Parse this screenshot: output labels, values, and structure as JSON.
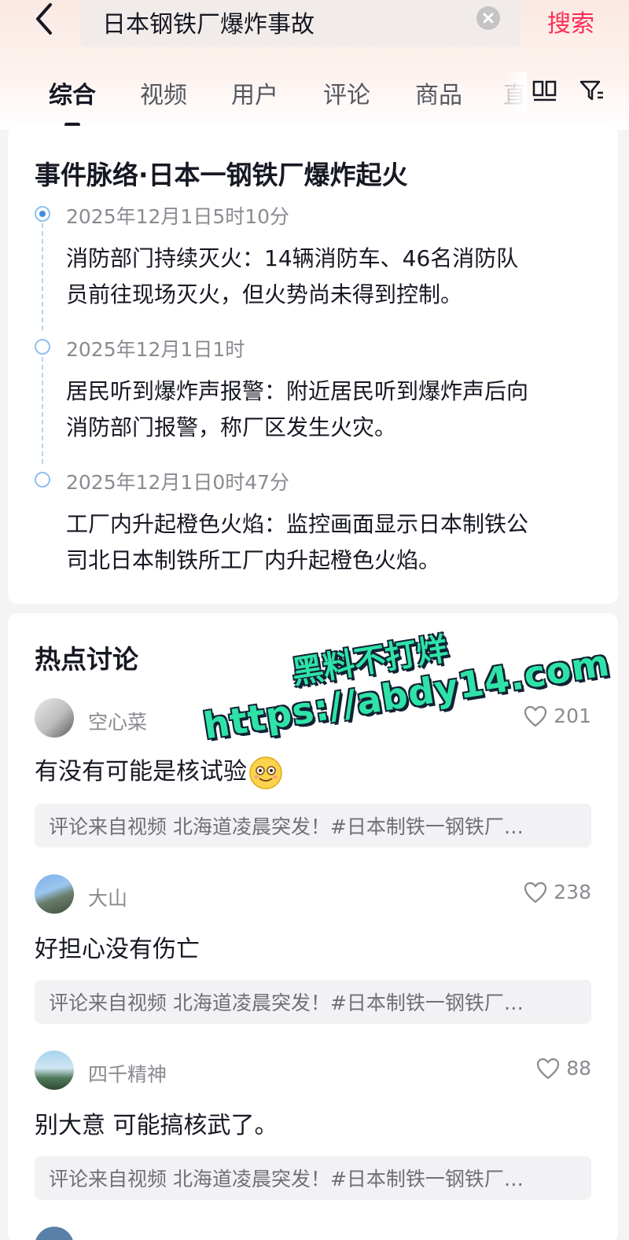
{
  "search": {
    "query": "日本钢铁厂爆炸事故",
    "action_label": "搜索"
  },
  "tabs": [
    {
      "label": "综合",
      "active": true
    },
    {
      "label": "视频",
      "active": false
    },
    {
      "label": "用户",
      "active": false
    },
    {
      "label": "评论",
      "active": false
    },
    {
      "label": "商品",
      "active": false
    },
    {
      "label": "直",
      "active": false
    }
  ],
  "timeline": {
    "title": "事件脉络·日本一钢铁厂爆炸起火",
    "events": [
      {
        "time": "2025年12月1日5时10分",
        "line1": "消防部门持续灭火：14辆消防车、46名消防队",
        "line2": "员前往现场灭火，但火势尚未得到控制。"
      },
      {
        "time": "2025年12月1日1时",
        "line1": "居民听到爆炸声报警：附近居民听到爆炸声后向",
        "line2": "消防部门报警，称厂区发生火灾。"
      },
      {
        "time": "2025年12月1日0时47分",
        "line1": "工厂内升起橙色火焰：监控画面显示日本制铁公",
        "line2": "司北日本制铁所工厂内升起橙色火焰。"
      }
    ]
  },
  "discussion": {
    "title": "热点讨论",
    "comments": [
      {
        "user": "空心菜",
        "likes": "201",
        "text": "有没有可能是核试验",
        "source": "评论来自视频 北海道凌晨突发！#日本制铁一钢铁厂…"
      },
      {
        "user": "大山",
        "likes": "238",
        "text": "好担心没有伤亡",
        "source": "评论来自视频 北海道凌晨突发！#日本制铁一钢铁厂…"
      },
      {
        "user": "四千精神",
        "likes": "88",
        "text": "别大意 可能搞核武了。",
        "source": "评论来自视频 北海道凌晨突发！#日本制铁一钢铁厂…"
      }
    ]
  },
  "watermark": {
    "line1": "黑料不打烊",
    "line2": "https://abdy14.com"
  },
  "colors": {
    "accent": "#fe2c55",
    "timeline": "#3d8ee6",
    "watermark": "#2fe3a8"
  }
}
